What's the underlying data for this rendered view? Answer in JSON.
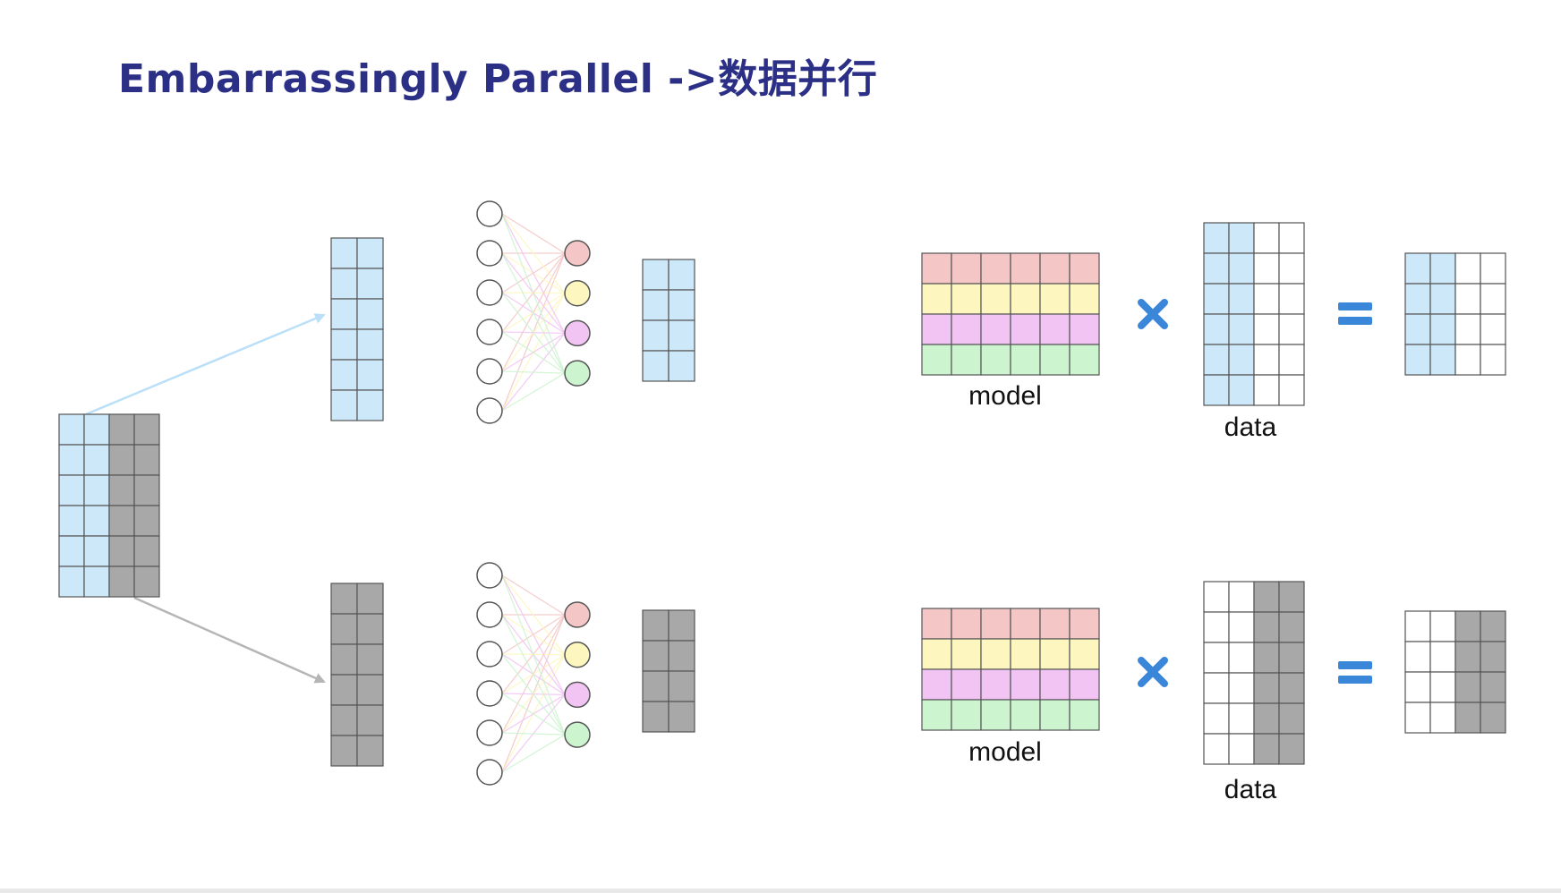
{
  "slide": {
    "title": "Embarrassingly Parallel ->数据并行"
  },
  "labels": {
    "model": "model",
    "data": "data"
  },
  "colors": {
    "title": "#2b2f86",
    "blue_cell": "#cde8f8",
    "gray_cell": "#a8a8a8",
    "white_cell": "#ffffff",
    "pink_row": "#f4c6c6",
    "yellow_row": "#fdf7bf",
    "purple_row": "#f1c4f4",
    "green_row": "#ccf4cf",
    "operator": "#3a86d8",
    "arrow_blue": "#b9e0f8",
    "arrow_gray": "#b5b5b5"
  },
  "icons": {
    "multiply": "multiply-icon",
    "equals": "equals-icon"
  }
}
